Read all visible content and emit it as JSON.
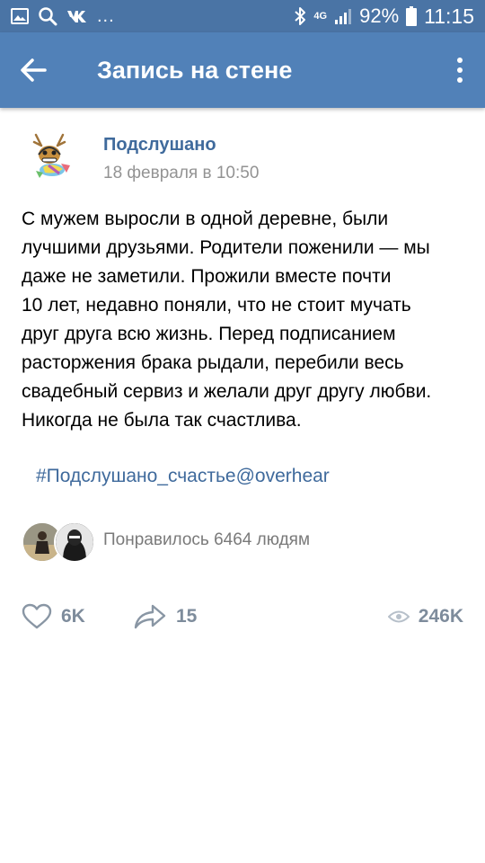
{
  "status_bar": {
    "network_label": "4G",
    "battery_percent": "92%",
    "time": "11:15",
    "more_indicator": "...",
    "icons": [
      "image-icon",
      "search-icon",
      "vk-icon",
      "bluetooth-icon",
      "signal-icon",
      "battery-icon"
    ]
  },
  "app_bar": {
    "title": "Запись на стене",
    "icons": [
      "back-arrow-icon",
      "more-vert-icon"
    ]
  },
  "post": {
    "author": "Подслушано",
    "date": "18 февраля в 10:50",
    "text": "С мужем выросли в одной деревне, были\nлучшими друзьями. Родители поженили — мы\nдаже не заметили. Прожили вместе  почти\n10 лет, недавно поняли, что не стоит мучать\nдруг друга всю жизнь. Перед подписанием\nрасторжения брака рыдали, перебили весь\nсвадебный сервиз и желали друг другу любви.\nНикогда не была так счастлива.",
    "hashtag": "#Подслушано_счастье@overhear",
    "liked_by_text": "Понравилось 6464 людям"
  },
  "actions": {
    "likes": "6K",
    "shares": "15",
    "views": "246K",
    "icons": [
      "heart-icon",
      "share-arrow-icon",
      "eye-icon"
    ]
  },
  "colors": {
    "status_bar_bg": "#4a74a5",
    "app_bar_bg": "#5181b8",
    "link": "#3f6a9c",
    "secondary_text": "#939393",
    "action_gray": "#7e8c9c"
  }
}
